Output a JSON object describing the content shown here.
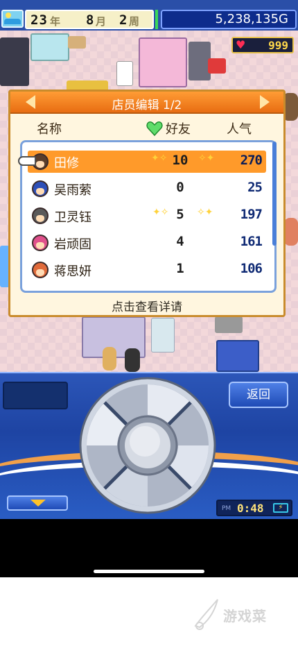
{
  "status": {
    "year": "23",
    "year_unit": "年",
    "month": "8",
    "month_unit": "月",
    "week": "2",
    "week_unit": "周",
    "money": "5,238,135G",
    "hearts": "999"
  },
  "dialog": {
    "title": "店员编辑 1/2",
    "col_name": "名称",
    "col_friend": "好友",
    "col_popularity": "人气",
    "hint": "点击查看详请",
    "staff": [
      {
        "name": "田修",
        "friend": "10",
        "popularity": "270",
        "avatar_color": "#5a3d2a"
      },
      {
        "name": "吴雨萦",
        "friend": "0",
        "popularity": "25",
        "avatar_color": "#2d4fb8"
      },
      {
        "name": "卫灵钰",
        "friend": "5",
        "popularity": "197",
        "avatar_color": "#5a5a5a"
      },
      {
        "name": "岩顽固",
        "friend": "4",
        "popularity": "161",
        "avatar_color": "#e0508c"
      },
      {
        "name": "蒋思妍",
        "friend": "1",
        "popularity": "106",
        "avatar_color": "#e06a3a"
      }
    ]
  },
  "controls": {
    "back_label": "返回",
    "ampm": "PM",
    "time": "0:48",
    "battery_symbol": "⚡"
  },
  "watermark": {
    "text": "游戏菜"
  },
  "colors": {
    "panel_blue": "#2c56b8",
    "header_orange": "#f08024",
    "selected_row": "#ff9a2a",
    "money_bg": "#0d2c8c"
  }
}
